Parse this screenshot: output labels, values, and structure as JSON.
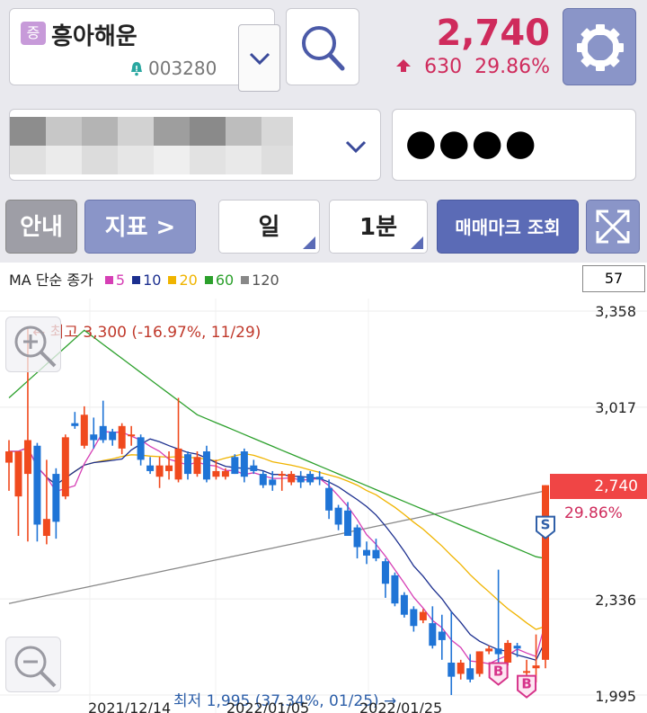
{
  "stock": {
    "badge": "증",
    "name": "흥아해운",
    "code": "003280",
    "price": "2,740",
    "change": "630",
    "change_pct": "29.86%"
  },
  "account": {
    "password_mask": "●●●●"
  },
  "toolbar": {
    "info_label": "안내",
    "indicator_label": "지표 >",
    "period_label": "일",
    "interval_label": "1분",
    "trade_mark_label": "매매마크 조회"
  },
  "legend": {
    "prefix": "MA 단순 종가",
    "items": [
      {
        "label": "5",
        "color": "#d63fb5"
      },
      {
        "label": "10",
        "color": "#1c2f8f"
      },
      {
        "label": "20",
        "color": "#f0b400"
      },
      {
        "label": "60",
        "color": "#2ca02c"
      },
      {
        "label": "120",
        "color": "#888888"
      }
    ]
  },
  "chart_data": {
    "type": "candlestick",
    "count": "57",
    "y_ticks": [
      "3,358",
      "3,017",
      "2,336",
      "1,995"
    ],
    "x_ticks": [
      "2021/12/14",
      "2022/01/05",
      "2022/01/25"
    ],
    "current_price": "2,740",
    "current_pct": "29.86%",
    "high_annotation": "← 최고 3,300 (-16.97%, 11/29)",
    "low_annotation": "최저 1,995 (37.34%, 01/25) →",
    "markers": [
      {
        "type": "S"
      },
      {
        "type": "B"
      },
      {
        "type": "B"
      }
    ],
    "colors": {
      "up": "#f04a1e",
      "down": "#1f74d6"
    }
  }
}
